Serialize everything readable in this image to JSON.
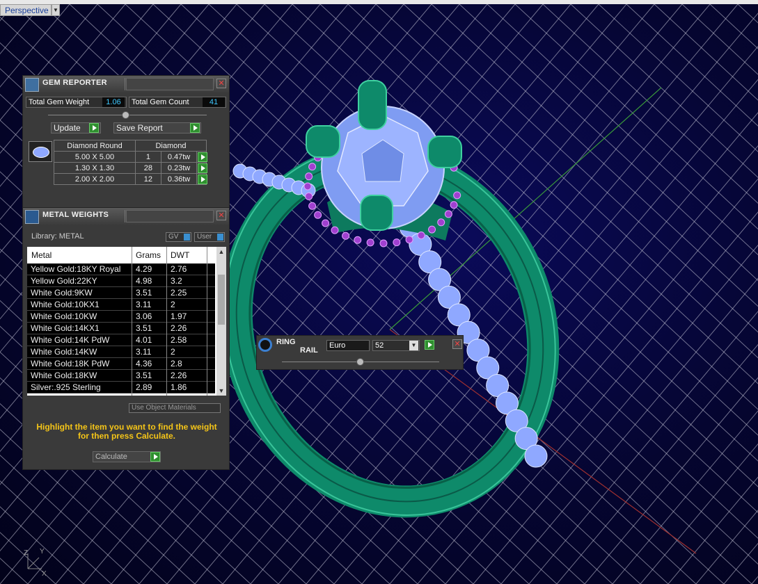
{
  "viewport": {
    "label": "Perspective",
    "axes": {
      "z": "Z",
      "y": "Y",
      "x": "X"
    }
  },
  "gem_reporter": {
    "title": "GEM REPORTER",
    "total_weight_label": "Total Gem Weight",
    "total_weight_value": "1.06",
    "total_count_label": "Total Gem Count",
    "total_count_value": "41",
    "update_label": "Update",
    "save_report_label": "Save Report",
    "table_header": {
      "shape": "Diamond Round",
      "type": "Diamond"
    },
    "rows": [
      {
        "size": "5.00 X 5.00",
        "count": "1",
        "weight": "0.47tw"
      },
      {
        "size": "1.30 X 1.30",
        "count": "28",
        "weight": "0.23tw"
      },
      {
        "size": "2.00 X 2.00",
        "count": "12",
        "weight": "0.36tw"
      }
    ]
  },
  "metal_weights": {
    "title": "METAL WEIGHTS",
    "library_label": "Library: METAL",
    "gv_label": "GV",
    "user_label": "User",
    "columns": [
      "Metal",
      "Grams",
      "DWT"
    ],
    "rows": [
      {
        "metal": "Yellow Gold:18KY Royal",
        "grams": "4.29",
        "dwt": "2.76"
      },
      {
        "metal": "Yellow Gold:22KY",
        "grams": "4.98",
        "dwt": "3.2"
      },
      {
        "metal": "White Gold:9KW",
        "grams": "3.51",
        "dwt": "2.25"
      },
      {
        "metal": "White Gold:10KX1",
        "grams": "3.11",
        "dwt": "2"
      },
      {
        "metal": "White Gold:10KW",
        "grams": "3.06",
        "dwt": "1.97"
      },
      {
        "metal": "White Gold:14KX1",
        "grams": "3.51",
        "dwt": "2.26"
      },
      {
        "metal": "White Gold:14K PdW",
        "grams": "4.01",
        "dwt": "2.58"
      },
      {
        "metal": "White Gold:14KW",
        "grams": "3.11",
        "dwt": "2"
      },
      {
        "metal": "White Gold:18K PdW",
        "grams": "4.36",
        "dwt": "2.8"
      },
      {
        "metal": "White Gold:18KW",
        "grams": "3.51",
        "dwt": "2.26"
      },
      {
        "metal": "Silver:.925 Sterling",
        "grams": "2.89",
        "dwt": "1.86"
      }
    ],
    "use_object_materials_label": "Use Object Materials",
    "message_line1": "Highlight the item you want to find the weight",
    "message_line2": "for then press Calculate.",
    "calculate_label": "Calculate"
  },
  "ring_rail": {
    "title_line1": "RING",
    "title_line2": "RAIL",
    "standard_value": "Euro",
    "size_value": "52"
  },
  "colors": {
    "grid": "#c8c8d8",
    "ring": "#0e8a6a",
    "gem": "#8fa8ff",
    "accent_gem": "#a040d0",
    "warning_text": "#f5c518"
  }
}
